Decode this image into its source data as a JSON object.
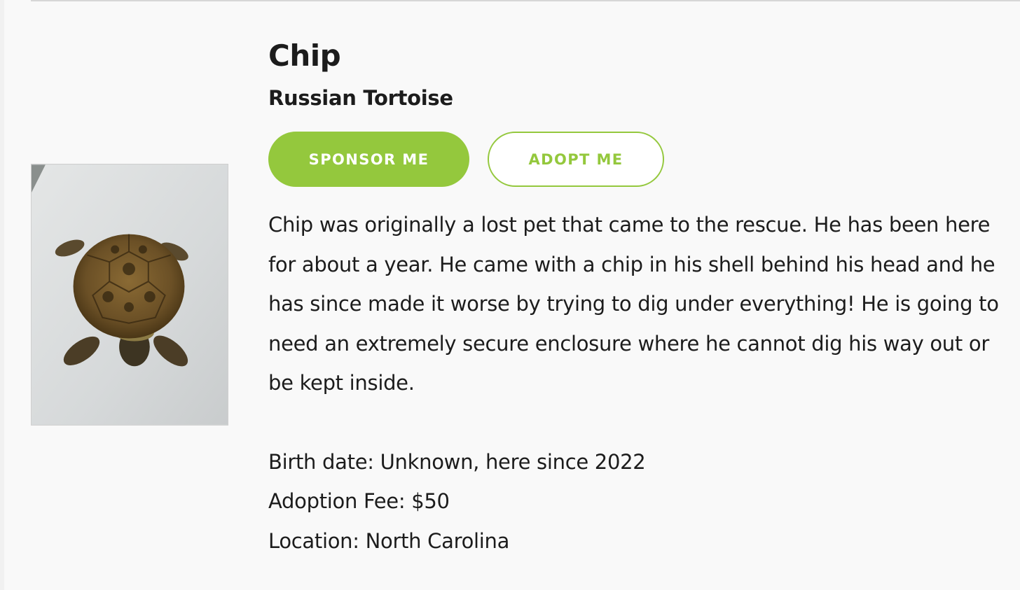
{
  "pet": {
    "name": "Chip",
    "species": "Russian Tortoise",
    "photo_icon": "tortoise-photo",
    "description": "Chip was originally a lost pet that came to the rescue. He has been here for about a year. He came with a chip in his shell behind his head and he has since made it worse by trying to dig under everything! He is going to need an extremely secure enclosure where he cannot dig his way out or be kept inside.",
    "facts": [
      "Birth date: Unknown, here since 2022",
      "Adoption Fee: $50",
      "Location: North Carolina"
    ]
  },
  "actions": {
    "sponsor_label": "SPONSOR ME",
    "adopt_label": "ADOPT ME"
  },
  "colors": {
    "accent": "#94c83d",
    "text": "#1c1c1c",
    "background": "#f9f9f9"
  }
}
